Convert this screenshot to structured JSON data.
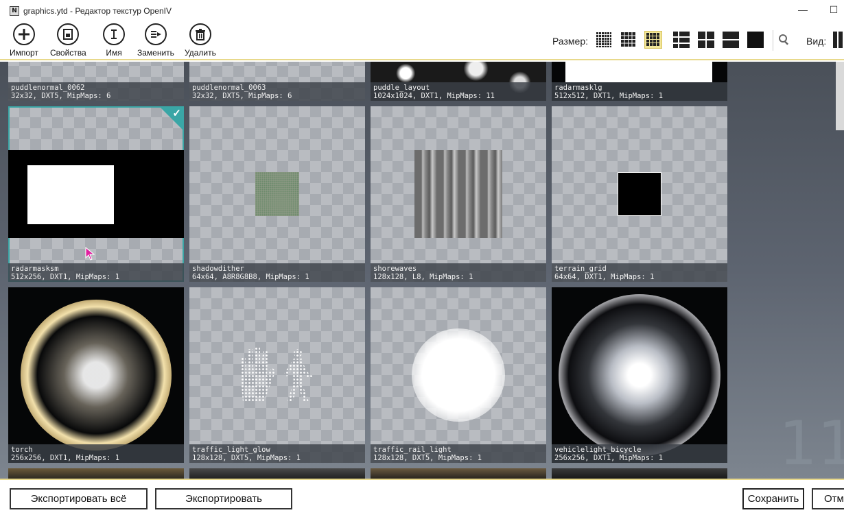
{
  "window": {
    "title": "graphics.ytd - Редактор текстур OpenIV",
    "app_icon_letter": "N",
    "minimize": "—",
    "maximize": "☐"
  },
  "toolbar": {
    "import_label": "Импорт",
    "properties_label": "Свойства",
    "name_label": "Имя",
    "replace_label": "Заменить",
    "delete_label": "Удалить",
    "size_label": "Размер:",
    "view_label": "Вид:"
  },
  "textures": [
    {
      "name": "puddlenormal_0062",
      "info": "32x32, DXT5, MipMaps: 6"
    },
    {
      "name": "puddlenormal_0063",
      "info": "32x32, DXT5, MipMaps: 6"
    },
    {
      "name": "puddle_layout",
      "info": "1024x1024, DXT1, MipMaps: 11"
    },
    {
      "name": "radarmasklg",
      "info": "512x512, DXT1, MipMaps: 1"
    },
    {
      "name": "radarmasksm",
      "info": "512x256, DXT1, MipMaps: 1"
    },
    {
      "name": "shadowdither",
      "info": "64x64, A8R8G8B8, MipMaps: 1"
    },
    {
      "name": "shorewaves",
      "info": "128x128, L8, MipMaps: 1"
    },
    {
      "name": "terrain_grid",
      "info": "64x64, DXT1, MipMaps: 1"
    },
    {
      "name": "torch",
      "info": "256x256, DXT1, MipMaps: 1"
    },
    {
      "name": "traffic_light_glow",
      "info": "128x128, DXT5, MipMaps: 1"
    },
    {
      "name": "traffic_rail_light",
      "info": "128x128, DXT5, MipMaps: 1"
    },
    {
      "name": "vehiclelight_bicycle",
      "info": "256x256, DXT1, MipMaps: 1"
    }
  ],
  "side_number": "11",
  "footer": {
    "export_all": "Экспортировать всё",
    "export": "Экспортировать",
    "save": "Сохранить",
    "cancel": "Отм"
  },
  "colors": {
    "selection": "#3aa6a6",
    "active_size": "#f3e79a",
    "accent_line": "#e8d98b"
  }
}
